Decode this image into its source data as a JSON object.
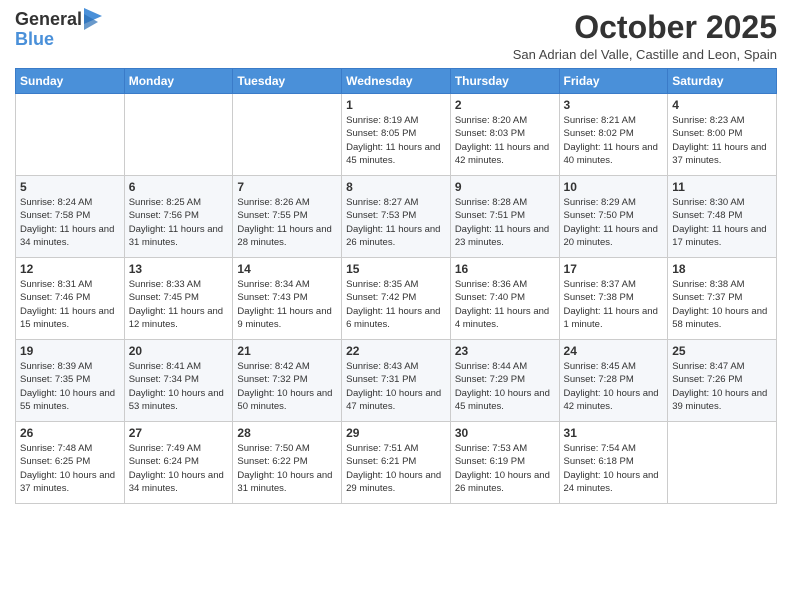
{
  "logo": {
    "line1": "General",
    "line2": "Blue"
  },
  "header": {
    "month_title": "October 2025",
    "subtitle": "San Adrian del Valle, Castille and Leon, Spain"
  },
  "days_of_week": [
    "Sunday",
    "Monday",
    "Tuesday",
    "Wednesday",
    "Thursday",
    "Friday",
    "Saturday"
  ],
  "weeks": [
    [
      {
        "day": "",
        "sunrise": "",
        "sunset": "",
        "daylight": ""
      },
      {
        "day": "",
        "sunrise": "",
        "sunset": "",
        "daylight": ""
      },
      {
        "day": "",
        "sunrise": "",
        "sunset": "",
        "daylight": ""
      },
      {
        "day": "1",
        "sunrise": "Sunrise: 8:19 AM",
        "sunset": "Sunset: 8:05 PM",
        "daylight": "Daylight: 11 hours and 45 minutes."
      },
      {
        "day": "2",
        "sunrise": "Sunrise: 8:20 AM",
        "sunset": "Sunset: 8:03 PM",
        "daylight": "Daylight: 11 hours and 42 minutes."
      },
      {
        "day": "3",
        "sunrise": "Sunrise: 8:21 AM",
        "sunset": "Sunset: 8:02 PM",
        "daylight": "Daylight: 11 hours and 40 minutes."
      },
      {
        "day": "4",
        "sunrise": "Sunrise: 8:23 AM",
        "sunset": "Sunset: 8:00 PM",
        "daylight": "Daylight: 11 hours and 37 minutes."
      }
    ],
    [
      {
        "day": "5",
        "sunrise": "Sunrise: 8:24 AM",
        "sunset": "Sunset: 7:58 PM",
        "daylight": "Daylight: 11 hours and 34 minutes."
      },
      {
        "day": "6",
        "sunrise": "Sunrise: 8:25 AM",
        "sunset": "Sunset: 7:56 PM",
        "daylight": "Daylight: 11 hours and 31 minutes."
      },
      {
        "day": "7",
        "sunrise": "Sunrise: 8:26 AM",
        "sunset": "Sunset: 7:55 PM",
        "daylight": "Daylight: 11 hours and 28 minutes."
      },
      {
        "day": "8",
        "sunrise": "Sunrise: 8:27 AM",
        "sunset": "Sunset: 7:53 PM",
        "daylight": "Daylight: 11 hours and 26 minutes."
      },
      {
        "day": "9",
        "sunrise": "Sunrise: 8:28 AM",
        "sunset": "Sunset: 7:51 PM",
        "daylight": "Daylight: 11 hours and 23 minutes."
      },
      {
        "day": "10",
        "sunrise": "Sunrise: 8:29 AM",
        "sunset": "Sunset: 7:50 PM",
        "daylight": "Daylight: 11 hours and 20 minutes."
      },
      {
        "day": "11",
        "sunrise": "Sunrise: 8:30 AM",
        "sunset": "Sunset: 7:48 PM",
        "daylight": "Daylight: 11 hours and 17 minutes."
      }
    ],
    [
      {
        "day": "12",
        "sunrise": "Sunrise: 8:31 AM",
        "sunset": "Sunset: 7:46 PM",
        "daylight": "Daylight: 11 hours and 15 minutes."
      },
      {
        "day": "13",
        "sunrise": "Sunrise: 8:33 AM",
        "sunset": "Sunset: 7:45 PM",
        "daylight": "Daylight: 11 hours and 12 minutes."
      },
      {
        "day": "14",
        "sunrise": "Sunrise: 8:34 AM",
        "sunset": "Sunset: 7:43 PM",
        "daylight": "Daylight: 11 hours and 9 minutes."
      },
      {
        "day": "15",
        "sunrise": "Sunrise: 8:35 AM",
        "sunset": "Sunset: 7:42 PM",
        "daylight": "Daylight: 11 hours and 6 minutes."
      },
      {
        "day": "16",
        "sunrise": "Sunrise: 8:36 AM",
        "sunset": "Sunset: 7:40 PM",
        "daylight": "Daylight: 11 hours and 4 minutes."
      },
      {
        "day": "17",
        "sunrise": "Sunrise: 8:37 AM",
        "sunset": "Sunset: 7:38 PM",
        "daylight": "Daylight: 11 hours and 1 minute."
      },
      {
        "day": "18",
        "sunrise": "Sunrise: 8:38 AM",
        "sunset": "Sunset: 7:37 PM",
        "daylight": "Daylight: 10 hours and 58 minutes."
      }
    ],
    [
      {
        "day": "19",
        "sunrise": "Sunrise: 8:39 AM",
        "sunset": "Sunset: 7:35 PM",
        "daylight": "Daylight: 10 hours and 55 minutes."
      },
      {
        "day": "20",
        "sunrise": "Sunrise: 8:41 AM",
        "sunset": "Sunset: 7:34 PM",
        "daylight": "Daylight: 10 hours and 53 minutes."
      },
      {
        "day": "21",
        "sunrise": "Sunrise: 8:42 AM",
        "sunset": "Sunset: 7:32 PM",
        "daylight": "Daylight: 10 hours and 50 minutes."
      },
      {
        "day": "22",
        "sunrise": "Sunrise: 8:43 AM",
        "sunset": "Sunset: 7:31 PM",
        "daylight": "Daylight: 10 hours and 47 minutes."
      },
      {
        "day": "23",
        "sunrise": "Sunrise: 8:44 AM",
        "sunset": "Sunset: 7:29 PM",
        "daylight": "Daylight: 10 hours and 45 minutes."
      },
      {
        "day": "24",
        "sunrise": "Sunrise: 8:45 AM",
        "sunset": "Sunset: 7:28 PM",
        "daylight": "Daylight: 10 hours and 42 minutes."
      },
      {
        "day": "25",
        "sunrise": "Sunrise: 8:47 AM",
        "sunset": "Sunset: 7:26 PM",
        "daylight": "Daylight: 10 hours and 39 minutes."
      }
    ],
    [
      {
        "day": "26",
        "sunrise": "Sunrise: 7:48 AM",
        "sunset": "Sunset: 6:25 PM",
        "daylight": "Daylight: 10 hours and 37 minutes."
      },
      {
        "day": "27",
        "sunrise": "Sunrise: 7:49 AM",
        "sunset": "Sunset: 6:24 PM",
        "daylight": "Daylight: 10 hours and 34 minutes."
      },
      {
        "day": "28",
        "sunrise": "Sunrise: 7:50 AM",
        "sunset": "Sunset: 6:22 PM",
        "daylight": "Daylight: 10 hours and 31 minutes."
      },
      {
        "day": "29",
        "sunrise": "Sunrise: 7:51 AM",
        "sunset": "Sunset: 6:21 PM",
        "daylight": "Daylight: 10 hours and 29 minutes."
      },
      {
        "day": "30",
        "sunrise": "Sunrise: 7:53 AM",
        "sunset": "Sunset: 6:19 PM",
        "daylight": "Daylight: 10 hours and 26 minutes."
      },
      {
        "day": "31",
        "sunrise": "Sunrise: 7:54 AM",
        "sunset": "Sunset: 6:18 PM",
        "daylight": "Daylight: 10 hours and 24 minutes."
      },
      {
        "day": "",
        "sunrise": "",
        "sunset": "",
        "daylight": ""
      }
    ]
  ]
}
